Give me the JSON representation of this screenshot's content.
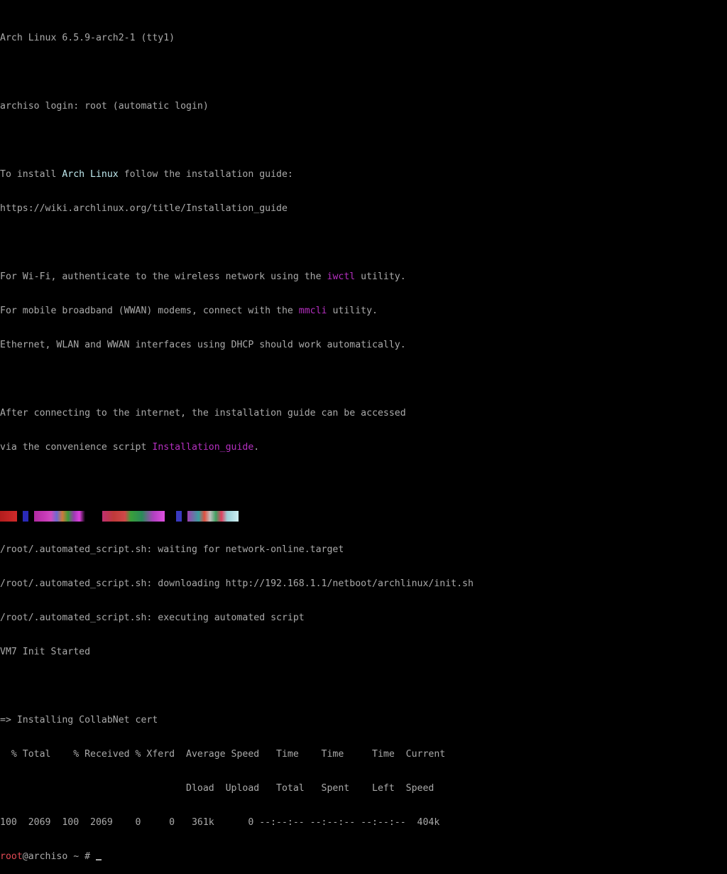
{
  "terminal": {
    "line1": "Arch Linux 6.5.9-arch2-1 (tty1)",
    "line2": "archiso login: root (automatic login)",
    "install": {
      "pre": "To install ",
      "highlight": "Arch Linux",
      "post": " follow the installation guide:",
      "url": "https://wiki.archlinux.org/title/Installation_guide"
    },
    "wifi": {
      "pre": "For Wi-Fi, authenticate to the wireless network using the ",
      "highlight": "iwctl",
      "post": " utility."
    },
    "mobile": {
      "pre": "For mobile broadband (WWAN) modems, connect with the ",
      "highlight": "mmcli",
      "post": " utility."
    },
    "ethernet": "Ethernet, WLAN and WWAN interfaces using DHCP should work automatically.",
    "after1": "After connecting to the internet, the installation guide can be accessed",
    "after2": {
      "pre": "via the convenience script ",
      "highlight": "Installation_guide",
      "post": "."
    },
    "script_lines": [
      "/root/.automated_script.sh: waiting for network-online.target",
      "/root/.automated_script.sh: downloading http://192.168.1.1/netboot/archlinux/init.sh",
      "/root/.automated_script.sh: executing automated script",
      "VM7 Init Started"
    ],
    "cert_line": "=> Installing CollabNet cert",
    "curl_header1": "  % Total    % Received % Xferd  Average Speed   Time    Time     Time  Current",
    "curl_header2": "                                 Dload  Upload   Total   Spent    Left  Speed",
    "curl_progress": "100  2069  100  2069    0     0   361k      0 --:--:-- --:--:-- --:--:--  404k",
    "prompt": {
      "user": "root",
      "rest": "@archiso ~ # "
    }
  },
  "colors": {
    "background": "#000000",
    "text": "#aaaaaa",
    "cyan_highlight": "#bfe9ee",
    "magenta_highlight": "#b42fbf",
    "prompt_user": "#e24a55"
  }
}
